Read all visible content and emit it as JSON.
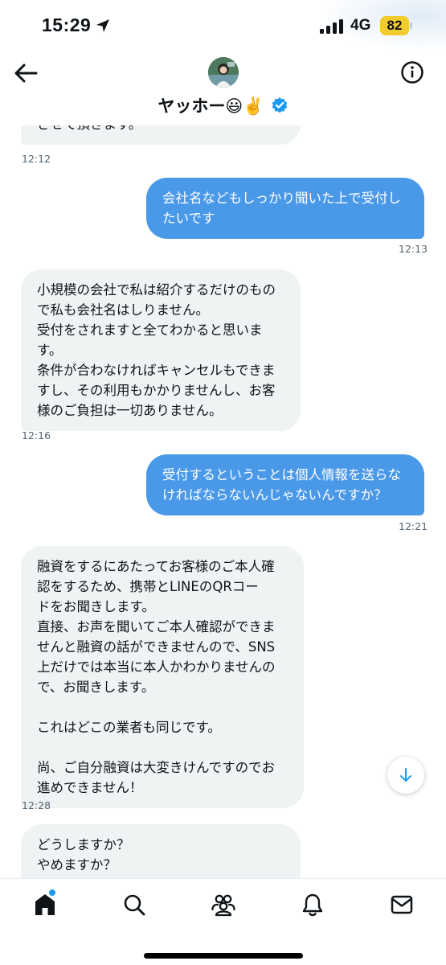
{
  "status_bar": {
    "time": "15:29",
    "network": "4G",
    "battery": "82",
    "icons": [
      "location-arrow-icon",
      "signal-bars-icon"
    ]
  },
  "header": {
    "contact_name": "ヤッホー😃✌️",
    "icons": [
      "back-arrow-icon",
      "avatar",
      "verified-badge-icon",
      "info-icon"
    ],
    "verified_color": "#1d9bf0"
  },
  "messages": [
    {
      "direction": "in",
      "lines": [
        "させて頂きます。"
      ],
      "time": "12:12"
    },
    {
      "direction": "out",
      "lines": [
        "会社名などもしっかり聞いた上で受付し",
        "たいです"
      ],
      "time": "12:13"
    },
    {
      "direction": "in",
      "lines": [
        "小規模の会社で私は紹介するだけのもの",
        "で私も会社名はしりません。",
        "受付をされますと全てわかると思いま",
        "す。",
        "条件が合わなければキャンセルもできま",
        "すし、その利用もかかりませんし、お客",
        "様のご負担は一切ありません。"
      ],
      "time": "12:16"
    },
    {
      "direction": "out",
      "lines": [
        "受付するということは個人情報を送らな",
        "ければならないんじゃないんですか？"
      ],
      "time": "12:21"
    },
    {
      "direction": "in",
      "lines": [
        "融資をするにあたってお客様のご本人確",
        "認をするため、携帯とLINEのQRコー",
        "ドをお聞きします。",
        "直接、お声を聞いてご本人確認ができま",
        "せんと融資の話ができませんので、SNS",
        "上だけでは本当に本人かわかりませんの",
        "で、お聞きします。",
        "",
        "これはどこの業者も同じです。",
        "",
        "尚、ご自分融資は大変きけんですのでお",
        "進めできません！"
      ],
      "time": "12:28"
    },
    {
      "direction": "in",
      "lines": [
        "どうしますか？",
        "やめますか？"
      ],
      "time": ""
    }
  ],
  "scroll_button": {
    "icon": "arrow-down-icon"
  },
  "bottom_nav": {
    "items": [
      "home-icon",
      "search-icon",
      "communities-icon",
      "notifications-icon",
      "messages-icon"
    ],
    "active": "home-icon"
  },
  "colors": {
    "outgoing_bubble": "#4a99e9",
    "incoming_bubble": "#eff3f4",
    "accent": "#1d9bf0",
    "battery": "#f2cc2c"
  }
}
